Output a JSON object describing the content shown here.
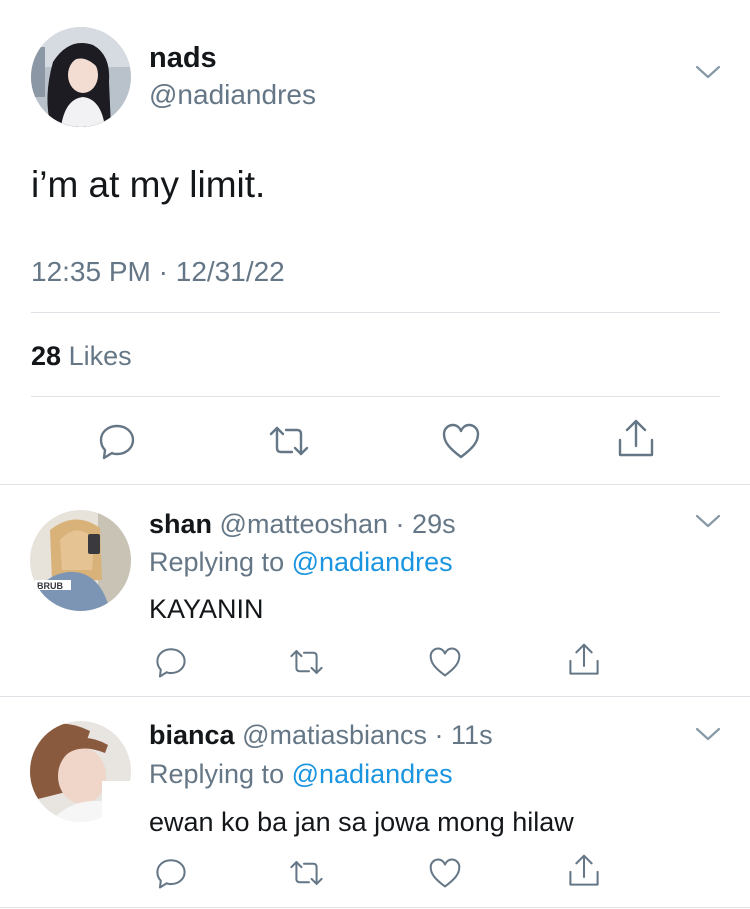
{
  "tweet": {
    "author": "nads",
    "handle": "@nadiandres",
    "text": "i’m at my limit.",
    "time": "12:35 PM",
    "date": "12/31/22",
    "likes_count": "28",
    "likes_label": "Likes"
  },
  "replies": [
    {
      "author": "shan",
      "handle": "@matteoshan",
      "age": "29s",
      "replying_to_label": "Replying to",
      "replying_to_handle": "@nadiandres",
      "text": "KAYANIN",
      "avatar_shirt_text": "BRUB"
    },
    {
      "author": "bianca",
      "handle": "@matiasbiancs",
      "age": "11s",
      "replying_to_label": "Replying to",
      "replying_to_handle": "@nadiandres",
      "text": "ewan ko ba jan sa jowa mong hilaw"
    }
  ],
  "icons": [
    "reply-icon",
    "retweet-icon",
    "like-icon",
    "share-icon",
    "chevron-down-icon"
  ],
  "colors": {
    "accent": "#1b95e0",
    "muted": "#657786",
    "divider": "#dfe3e7"
  }
}
